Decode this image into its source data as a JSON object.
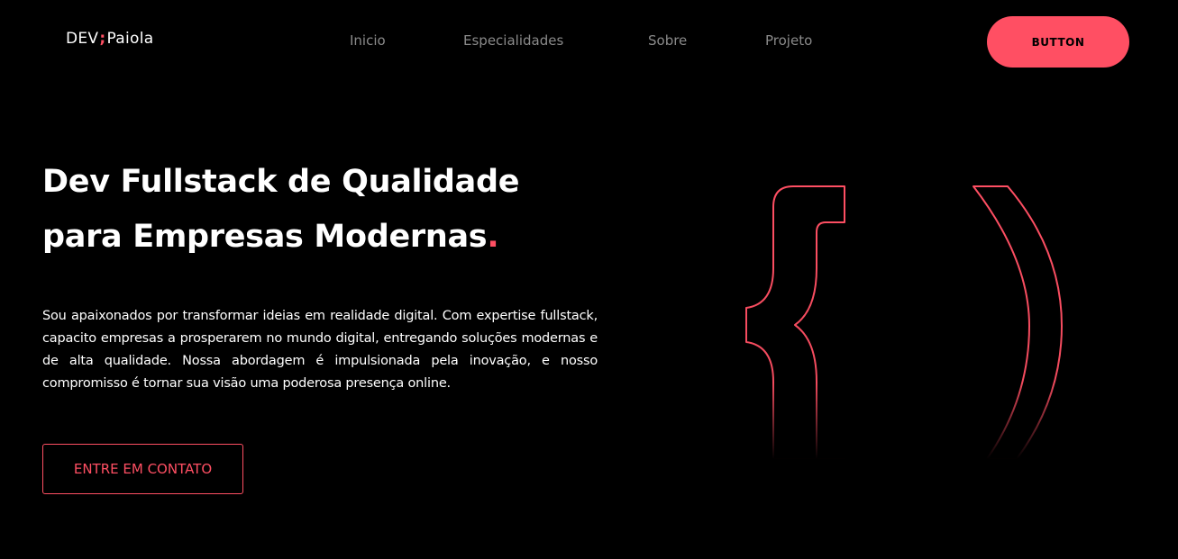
{
  "header": {
    "logo": {
      "part1": "DEV",
      "mark": ";",
      "part2": "Paiola"
    },
    "nav": [
      {
        "label": "Inicio"
      },
      {
        "label": "Especialidades"
      },
      {
        "label": "Sobre"
      },
      {
        "label": "Projeto"
      }
    ],
    "cta_label": "BUTTON"
  },
  "hero": {
    "title_line1": "Dev Fullstack de Qualidade",
    "title_line2": "para Empresas Modernas",
    "title_dot": ".",
    "description": "Sou apaixonados por transformar ideias em realidade digital. Com expertise fullstack, capacito empresas a prosperarem no mundo digital, entregando soluções modernas e de alta qualidade. Nossa abordagem é impulsionada pela inovação, e nosso compromisso é tornar sua visão uma poderosa presença online.",
    "contact_label": "ENTRE EM CONTATO",
    "graphic_icon": "code-brace-paren-icon"
  },
  "colors": {
    "background": "#000000",
    "accent": "#ff4f63",
    "text": "#ffffff",
    "nav_text": "#8a8a8a"
  }
}
